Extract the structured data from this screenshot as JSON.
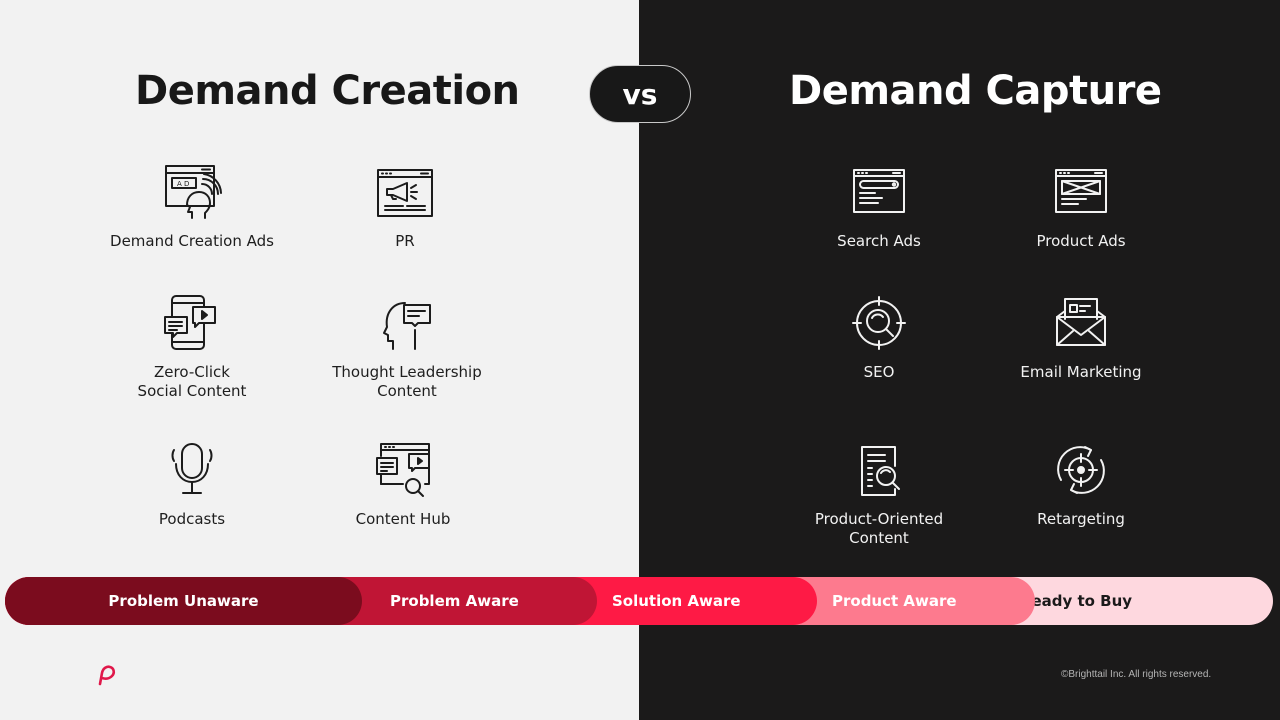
{
  "left": {
    "title": "Demand Creation",
    "items": [
      {
        "label": "Demand Creation Ads",
        "icon": "ad-listener-icon"
      },
      {
        "label": "PR",
        "icon": "megaphone-browser-icon"
      },
      {
        "label": "Zero-Click\nSocial Content",
        "icon": "phone-chat-icon"
      },
      {
        "label": "Thought Leadership\nContent",
        "icon": "head-speech-icon"
      },
      {
        "label": "Podcasts",
        "icon": "microphone-icon"
      },
      {
        "label": "Content Hub",
        "icon": "content-hub-icon"
      }
    ]
  },
  "vs_label": "vs",
  "right": {
    "title": "Demand Capture",
    "items": [
      {
        "label": "Search Ads",
        "icon": "search-browser-icon"
      },
      {
        "label": "Product Ads",
        "icon": "product-browser-icon"
      },
      {
        "label": "SEO",
        "icon": "seo-target-icon"
      },
      {
        "label": "Email Marketing",
        "icon": "email-icon"
      },
      {
        "label": "Product-Oriented\nContent",
        "icon": "document-search-icon"
      },
      {
        "label": "Retargeting",
        "icon": "retargeting-icon"
      }
    ]
  },
  "funnel": {
    "stages": [
      {
        "label": "Problem Unaware",
        "color": "#7b0c1e",
        "text_color": "#ffffff"
      },
      {
        "label": "Problem Aware",
        "color": "#c01535",
        "text_color": "#ffffff"
      },
      {
        "label": "Solution Aware",
        "color": "#fe1a45",
        "text_color": "#ffffff"
      },
      {
        "label": "Product Aware",
        "color": "#fd7a8e",
        "text_color": "#ffffff"
      },
      {
        "label": "Ready to Buy",
        "color": "#fed8df",
        "text_color": "#1b1a1a"
      }
    ]
  },
  "brand": {
    "accent": "#e0184a",
    "logo": "brighttail-logo-icon"
  },
  "copyright": "©Brighttail Inc. All rights reserved."
}
